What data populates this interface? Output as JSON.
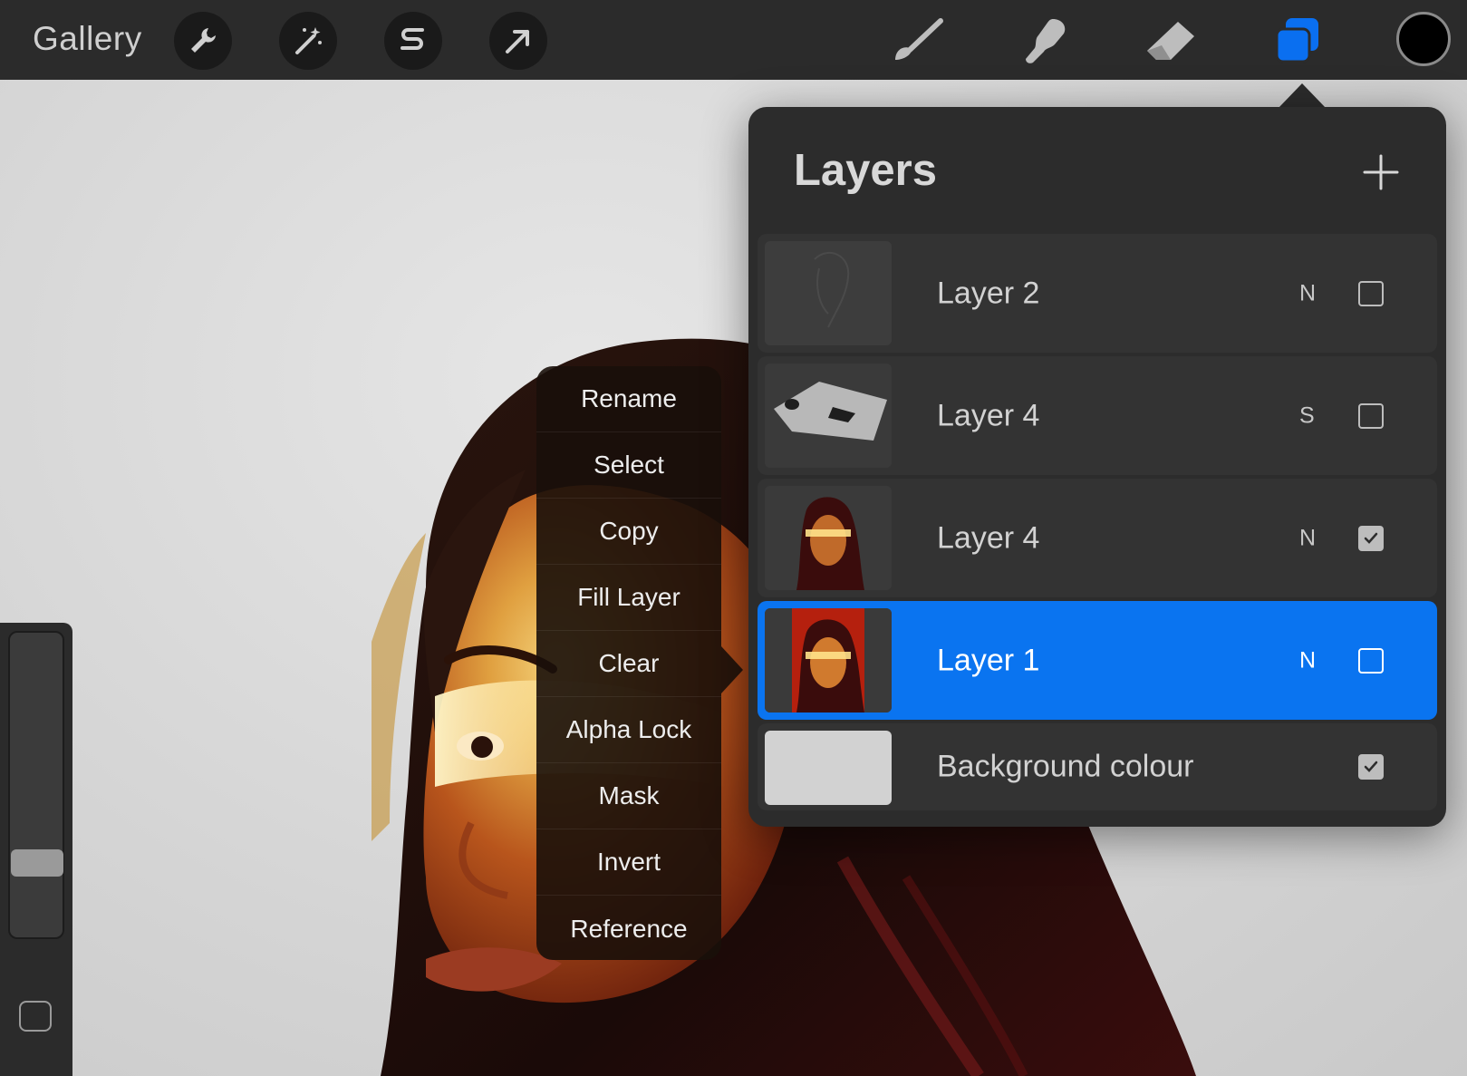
{
  "topbar": {
    "gallery_label": "Gallery",
    "left_tools": [
      "wrench-icon",
      "magic-wand-icon",
      "selection-s-icon",
      "transform-arrow-icon"
    ],
    "right_tools": [
      "brush-icon",
      "smudge-icon",
      "eraser-icon",
      "layers-icon"
    ],
    "active_tool_color": "#0a6ff0",
    "current_color": "#000000"
  },
  "layers_panel": {
    "title": "Layers",
    "layers": [
      {
        "name": "Layer 2",
        "mode": "N",
        "visible": false,
        "selected": false
      },
      {
        "name": "Layer 4",
        "mode": "S",
        "visible": false,
        "selected": false
      },
      {
        "name": "Layer 4",
        "mode": "N",
        "visible": true,
        "selected": false
      },
      {
        "name": "Layer 1",
        "mode": "N",
        "visible": false,
        "selected": true
      },
      {
        "name": "Background colour",
        "mode": "",
        "visible": true,
        "selected": false
      }
    ],
    "selected_color": "#0a74f0"
  },
  "layer_menu": {
    "items": [
      "Rename",
      "Select",
      "Copy",
      "Fill Layer",
      "Clear",
      "Alpha Lock",
      "Mask",
      "Invert",
      "Reference"
    ]
  },
  "sidebar": {
    "brush_size_level": 0.22
  }
}
